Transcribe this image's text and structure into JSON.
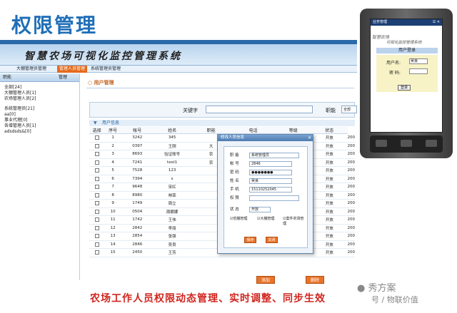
{
  "slide": {
    "title": "权限管理",
    "caption": "农场工作人员权限动态管理、实时调整、同步生效",
    "watermark_line1": "秀方案",
    "watermark_line2": "号 / 物联价值"
  },
  "app": {
    "banner_title": "智慧农场可视化监控管理系统",
    "menu": [
      "大棚管理员管理",
      "管理人员管理",
      "系统管理员管理"
    ],
    "active_menu_index": 1
  },
  "sidebar": {
    "head_left": "职能",
    "head_right": "管理",
    "items": [
      "全部[24]",
      "大棚管理人员[1]",
      "农场管理人员[2]",
      "系统管理员[21]",
      "aa[0]",
      "事业代理[0]",
      "各增管理人员[1]",
      "adsdsds&[0]"
    ]
  },
  "main": {
    "breadcrumb": "用户管理",
    "search_label": "关键字",
    "role_label": "职能",
    "role_value": "全部",
    "section_label": "用户信息",
    "columns": [
      "选择",
      "序号",
      "帐号",
      "姓名",
      "职能",
      "电话",
      "等级",
      "状态"
    ],
    "rows": [
      [
        "1",
        "3242",
        "345",
        "",
        "",
        "",
        "开放",
        "200"
      ],
      [
        "2",
        "0397",
        "王刚",
        "大",
        "",
        "",
        "开放",
        "200"
      ],
      [
        "3",
        "8693",
        "验证账号",
        "农",
        "",
        "",
        "开放",
        "200"
      ],
      [
        "4",
        "7241",
        "test1",
        "农",
        "",
        "",
        "开放",
        "200"
      ],
      [
        "5",
        "7528",
        "123",
        "",
        "",
        "",
        "开放",
        "200"
      ],
      [
        "6",
        "7394",
        "s",
        "",
        "",
        "",
        "开放",
        "200"
      ],
      [
        "7",
        "9648",
        "宋红",
        "",
        "",
        "",
        "开放",
        "200"
      ],
      [
        "8",
        "8980",
        "林荣",
        "",
        "",
        "",
        "开放",
        "200"
      ],
      [
        "9",
        "1749",
        "周立",
        "",
        "",
        "",
        "开放",
        "200"
      ],
      [
        "10",
        "0504",
        "周娜娜",
        "",
        "",
        "",
        "开放",
        "200"
      ],
      [
        "11",
        "1742",
        "王伟",
        "",
        "",
        "",
        "开放",
        "200"
      ],
      [
        "12",
        "2842",
        "李丽",
        "",
        "",
        "",
        "开放",
        "200"
      ],
      [
        "13",
        "2854",
        "张强",
        "",
        "",
        "",
        "开放",
        "200"
      ],
      [
        "14",
        "2846",
        "吴良",
        "",
        "",
        "",
        "开放",
        "200"
      ],
      [
        "15",
        "2450",
        "王芳",
        "",
        "",
        "",
        "开放",
        "200"
      ]
    ],
    "add_label": "添加",
    "delete_label": "删除"
  },
  "dialog": {
    "title": "修改人员信息",
    "fields": {
      "role_label": "职 能",
      "role_value": "系统管理员",
      "account_label": "帐 号",
      "account_value": "2846",
      "password_label": "密 码",
      "password_value": "●●●●●●●",
      "name_label": "姓 名",
      "name_value": "吴良",
      "phone_label": "手 机",
      "phone_value": "15110252045",
      "permission_label": "权 限",
      "permission_value": "",
      "status_label": "状 态",
      "status_value": "开放"
    },
    "checkboxes": [
      "低棚管理",
      "大棚管理",
      "案件农场管理"
    ],
    "save_label": "保存",
    "close_label": "关闭"
  },
  "phone": {
    "status_text": "业务管理",
    "app_line1": "智慧农场",
    "app_line2": "可视化监控管理系统",
    "login_title": "用户登录",
    "username_label": "用户名:",
    "username_value": "吴良",
    "password_label": "密 码:",
    "password_value": "",
    "login_button": "登录"
  },
  "colors": {
    "title_blue": "#1f6fb7",
    "accent_orange": "#e8732a",
    "caption_red": "#d0261f"
  }
}
